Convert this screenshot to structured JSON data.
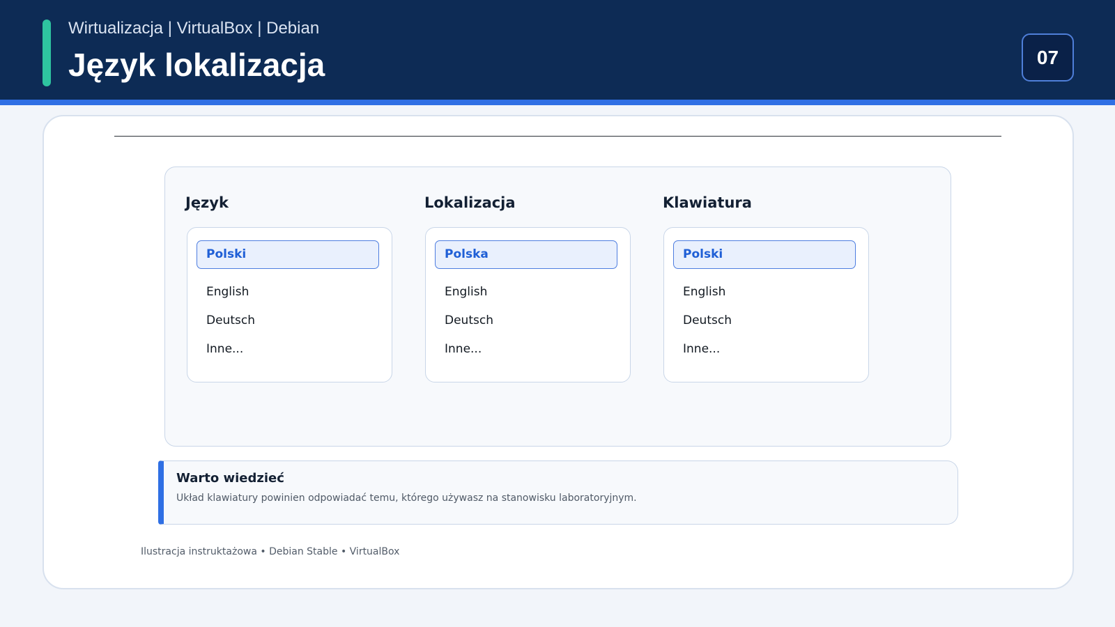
{
  "header": {
    "subtitle": "Wirtualizacja | VirtualBox | Debian",
    "title": "Język lokalizacja",
    "slide_number": "07"
  },
  "columns": [
    {
      "title": "Język",
      "selected": "Polski",
      "options": [
        "English",
        "Deutsch",
        "Inne..."
      ]
    },
    {
      "title": "Lokalizacja",
      "selected": "Polska",
      "options": [
        "English",
        "Deutsch",
        "Inne..."
      ]
    },
    {
      "title": "Klawiatura",
      "selected": "Polski",
      "options": [
        "English",
        "Deutsch",
        "Inne..."
      ]
    }
  ],
  "tip": {
    "title": "Warto wiedzieć",
    "text": "Układ klawiatury powinien odpowiadać temu, którego używasz na stanowisku laboratoryjnym."
  },
  "footer": {
    "note": "Ilustracja instruktażowa • Debian Stable • VirtualBox"
  },
  "colors": {
    "header_bg": "#0d2b55",
    "accent_blue": "#2f6fe4",
    "accent_green": "#2ec4a0",
    "selected_text": "#1f5fd6"
  }
}
